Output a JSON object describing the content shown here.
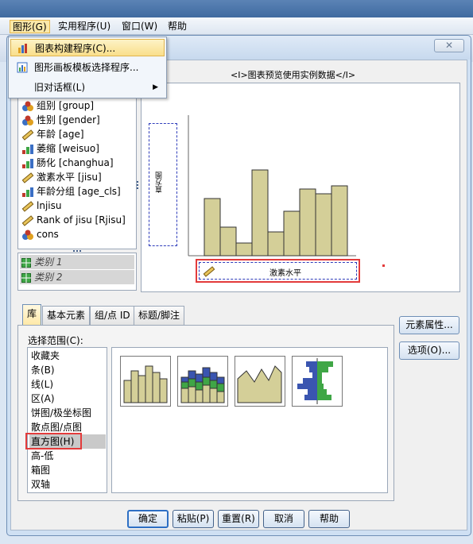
{
  "menubar": {
    "items": [
      {
        "label": "图形(G)",
        "active": true
      },
      {
        "label": "实用程序(U)"
      },
      {
        "label": "窗口(W)"
      },
      {
        "label": "帮助"
      }
    ]
  },
  "dialog": {
    "close_label": "✕"
  },
  "menu": {
    "items": [
      {
        "label": "图表构建程序(C)...",
        "highlighted": true,
        "icon": "chart-builder-icon"
      },
      {
        "label": "图形画板模板选择程序...",
        "icon": "graphboard-icon"
      },
      {
        "label": "旧对话框(L)",
        "submenu": true
      }
    ]
  },
  "variables": [
    {
      "label": "组别 [group]",
      "type": "nominal"
    },
    {
      "label": "性别 [gender]",
      "type": "nominal"
    },
    {
      "label": "年龄 [age]",
      "type": "scale"
    },
    {
      "label": "萎缩 [weisuo]",
      "type": "ordinal"
    },
    {
      "label": "肠化 [changhua]",
      "type": "ordinal"
    },
    {
      "label": "激素水平 [jisu]",
      "type": "scale"
    },
    {
      "label": "年龄分组 [age_cls]",
      "type": "ordinal"
    },
    {
      "label": "lnjisu",
      "type": "scale"
    },
    {
      "label": "Rank of jisu [Rjisu]",
      "type": "scale"
    },
    {
      "label": "cons",
      "type": "nominal"
    }
  ],
  "categories": [
    {
      "label": "类别 1"
    },
    {
      "label": "类别 2"
    }
  ],
  "preview": {
    "label": "<I>图表预览使用实例数据</I>",
    "y_axis_label": "直方图",
    "x_axis_label": "激素水平",
    "bars": [
      0.36,
      0.18,
      0.08,
      0.54,
      0.15,
      0.28,
      0.42,
      0.39,
      0.44
    ]
  },
  "tabs": [
    {
      "label": "库",
      "active": true
    },
    {
      "label": "基本元素"
    },
    {
      "label": "组/点 ID"
    },
    {
      "label": "标题/脚注"
    }
  ],
  "gallery": {
    "choose_label": "选择范围(C):",
    "items": [
      {
        "label": "收藏夹"
      },
      {
        "label": "条(B)"
      },
      {
        "label": "线(L)"
      },
      {
        "label": "区(A)"
      },
      {
        "label": "饼图/极坐标图"
      },
      {
        "label": "散点图/点图"
      },
      {
        "label": "直方图(H)",
        "selected": true
      },
      {
        "label": "高-低"
      },
      {
        "label": "箱图"
      },
      {
        "label": "双轴"
      }
    ]
  },
  "right_buttons": {
    "element_props": "元素属性...",
    "options": "选项(O)..."
  },
  "bottom_buttons": {
    "ok": "确定",
    "paste": "粘贴(P)",
    "reset": "重置(R)",
    "cancel": "取消",
    "help": "帮助"
  },
  "colors": {
    "bar_fill": "#d4cf98",
    "bar_stroke": "#333333",
    "highlight_red": "#e33b3b",
    "drop_zone_blue": "#2f3dbb",
    "stack_blue": "#3a55b0",
    "stack_green": "#3fa646"
  }
}
